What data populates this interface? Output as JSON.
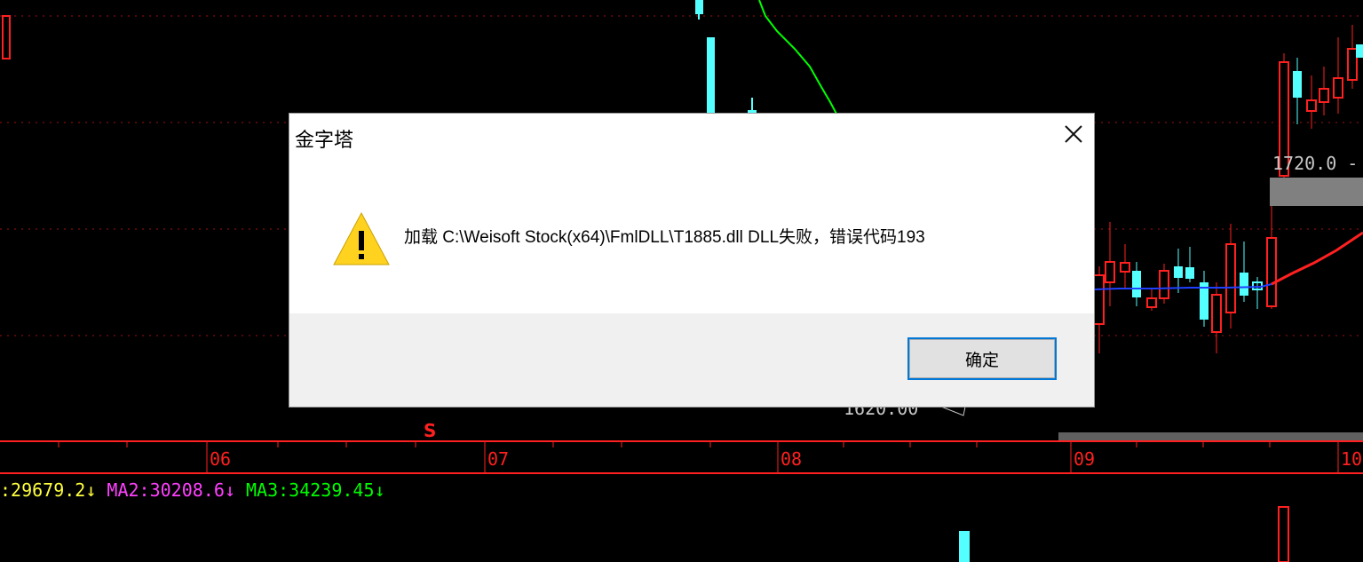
{
  "chart": {
    "date_axis_labels": [
      "06",
      "07",
      "08",
      "09",
      "10"
    ],
    "signal_marker": "S",
    "price_label_upper": "1720.0 -",
    "price_label_lower": "1620.00"
  },
  "indicators": {
    "ma1_text": ":29679.2",
    "ma1_arrow": "↓",
    "ma2_name": "MA2:",
    "ma2_value": "30208.6",
    "ma2_arrow": "↓",
    "ma3_name": "MA3:",
    "ma3_value": "34239.45",
    "ma3_arrow": "↓"
  },
  "dialog": {
    "title": "金字塔",
    "close_icon": "close-icon",
    "warning_icon": "warning-icon",
    "message": "加载 C:\\Weisoft Stock(x64)\\FmlDLL\\T1885.dll DLL失败，错误代码193",
    "ok_label": "确定"
  },
  "colors": {
    "background": "#000000",
    "grid_red": "#ff2020",
    "candle_up": "#ff2020",
    "candle_down": "#54ffff",
    "ma_green": "#00ff00",
    "ma_blue": "#2040ff",
    "ma1_color": "#ffff40",
    "ma2_color": "#ff40ff",
    "ma3_color": "#00ff00",
    "dialog_accent": "#0078d7"
  }
}
